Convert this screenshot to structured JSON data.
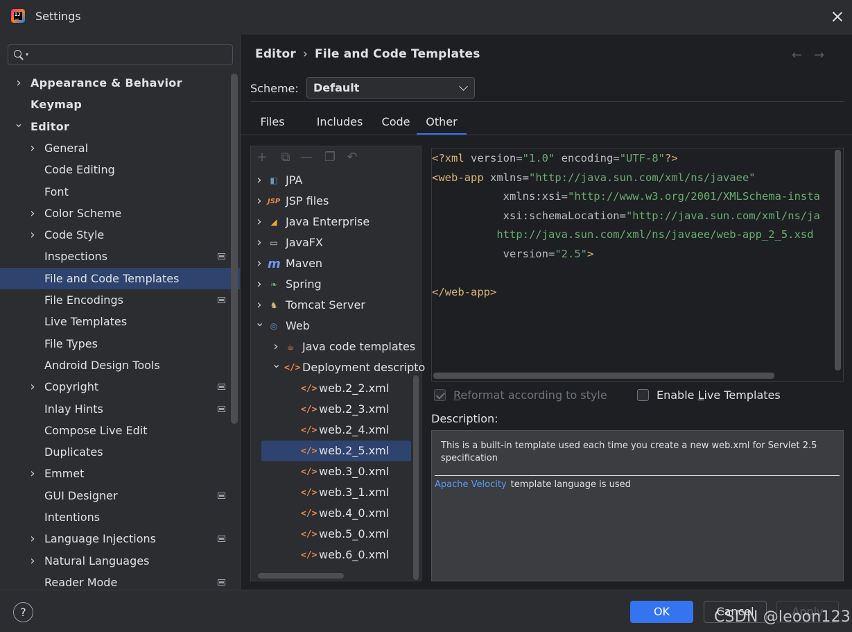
{
  "window": {
    "title": "Settings"
  },
  "sidebar": {
    "search": {
      "value": "",
      "placeholder": ""
    },
    "items": [
      {
        "label": "Appearance & Behavior",
        "expandable": true,
        "expanded": false,
        "bold": true,
        "level": 0,
        "badge": false
      },
      {
        "label": "Keymap",
        "expandable": false,
        "bold": true,
        "level": 0,
        "badge": false
      },
      {
        "label": "Editor",
        "expandable": true,
        "expanded": true,
        "bold": true,
        "level": 0,
        "badge": false
      },
      {
        "label": "General",
        "expandable": true,
        "expanded": false,
        "level": 1,
        "badge": false
      },
      {
        "label": "Code Editing",
        "expandable": false,
        "level": 1,
        "badge": false
      },
      {
        "label": "Font",
        "expandable": false,
        "level": 1,
        "badge": false
      },
      {
        "label": "Color Scheme",
        "expandable": true,
        "expanded": false,
        "level": 1,
        "badge": false
      },
      {
        "label": "Code Style",
        "expandable": true,
        "expanded": false,
        "level": 1,
        "badge": false
      },
      {
        "label": "Inspections",
        "expandable": false,
        "level": 1,
        "badge": true
      },
      {
        "label": "File and Code Templates",
        "expandable": false,
        "level": 1,
        "badge": false,
        "selected": true
      },
      {
        "label": "File Encodings",
        "expandable": false,
        "level": 1,
        "badge": true
      },
      {
        "label": "Live Templates",
        "expandable": false,
        "level": 1,
        "badge": false
      },
      {
        "label": "File Types",
        "expandable": false,
        "level": 1,
        "badge": false
      },
      {
        "label": "Android Design Tools",
        "expandable": false,
        "level": 1,
        "badge": false
      },
      {
        "label": "Copyright",
        "expandable": true,
        "expanded": false,
        "level": 1,
        "badge": true
      },
      {
        "label": "Inlay Hints",
        "expandable": false,
        "level": 1,
        "badge": true
      },
      {
        "label": "Compose Live Edit",
        "expandable": false,
        "level": 1,
        "badge": false
      },
      {
        "label": "Duplicates",
        "expandable": false,
        "level": 1,
        "badge": false
      },
      {
        "label": "Emmet",
        "expandable": true,
        "expanded": false,
        "level": 1,
        "badge": false
      },
      {
        "label": "GUI Designer",
        "expandable": false,
        "level": 1,
        "badge": true
      },
      {
        "label": "Intentions",
        "expandable": false,
        "level": 1,
        "badge": false
      },
      {
        "label": "Language Injections",
        "expandable": true,
        "expanded": false,
        "level": 1,
        "badge": true
      },
      {
        "label": "Natural Languages",
        "expandable": true,
        "expanded": false,
        "level": 1,
        "badge": false
      },
      {
        "label": "Reader Mode",
        "expandable": false,
        "level": 1,
        "badge": true
      }
    ]
  },
  "breadcrumb": {
    "parent": "Editor",
    "separator": "›",
    "current": "File and Code Templates"
  },
  "nav": {
    "back": "←",
    "forward": "→"
  },
  "scheme": {
    "label": "Scheme:",
    "value": "Default"
  },
  "tabs": [
    {
      "label": "Files",
      "active": false
    },
    {
      "label": "Includes",
      "active": false
    },
    {
      "label": "Code",
      "active": false
    },
    {
      "label": "Other",
      "active": true
    }
  ],
  "tree_toolbar": {
    "add": "+",
    "copy": "⧉",
    "remove": "—",
    "duplicate": "❐",
    "reset": "↶"
  },
  "tree": [
    {
      "label": "JPA",
      "icon": "jpa-icon",
      "glyph": "◧",
      "color": "#6897bb",
      "level": 0,
      "expandable": true,
      "expanded": false
    },
    {
      "label": "JSP files",
      "icon": "jsp-icon",
      "glyph": "JSP",
      "color": "#e8884b",
      "level": 0,
      "expandable": true,
      "expanded": false
    },
    {
      "label": "Java Enterprise",
      "icon": "java-enterprise-icon",
      "glyph": "◢",
      "color": "#f0a732",
      "level": 0,
      "expandable": true,
      "expanded": false
    },
    {
      "label": "JavaFX",
      "icon": "folder-icon",
      "glyph": "▭",
      "color": "#ced0d6",
      "level": 0,
      "expandable": true,
      "expanded": false
    },
    {
      "label": "Maven",
      "icon": "maven-icon",
      "glyph": "m",
      "color": "#6e96f0",
      "level": 0,
      "expandable": true,
      "expanded": false
    },
    {
      "label": "Spring",
      "icon": "spring-icon",
      "glyph": "❧",
      "color": "#6aab73",
      "level": 0,
      "expandable": true,
      "expanded": false
    },
    {
      "label": "Tomcat Server",
      "icon": "tomcat-icon",
      "glyph": "♞",
      "color": "#d5b778",
      "level": 0,
      "expandable": true,
      "expanded": false
    },
    {
      "label": "Web",
      "icon": "web-icon",
      "glyph": "◎",
      "color": "#6897bb",
      "level": 0,
      "expandable": true,
      "expanded": true
    },
    {
      "label": "Java code templates",
      "icon": "java-cup-icon",
      "glyph": "☕",
      "color": "#e8884b",
      "level": 1,
      "expandable": true,
      "expanded": false
    },
    {
      "label": "Deployment descripto",
      "icon": "code-tag-icon",
      "glyph": "</>",
      "color": "#e8884b",
      "level": 1,
      "expandable": true,
      "expanded": true
    },
    {
      "label": "web.2_2.xml",
      "icon": "code-tag-icon",
      "glyph": "</>",
      "color": "#e8884b",
      "level": 2,
      "expandable": false
    },
    {
      "label": "web.2_3.xml",
      "icon": "code-tag-icon",
      "glyph": "</>",
      "color": "#e8884b",
      "level": 2,
      "expandable": false
    },
    {
      "label": "web.2_4.xml",
      "icon": "code-tag-icon",
      "glyph": "</>",
      "color": "#e8884b",
      "level": 2,
      "expandable": false
    },
    {
      "label": "web.2_5.xml",
      "icon": "code-tag-icon",
      "glyph": "</>",
      "color": "#e8884b",
      "level": 2,
      "expandable": false,
      "selected": true
    },
    {
      "label": "web.3_0.xml",
      "icon": "code-tag-icon",
      "glyph": "</>",
      "color": "#e8884b",
      "level": 2,
      "expandable": false
    },
    {
      "label": "web.3_1.xml",
      "icon": "code-tag-icon",
      "glyph": "</>",
      "color": "#e8884b",
      "level": 2,
      "expandable": false
    },
    {
      "label": "web.4_0.xml",
      "icon": "code-tag-icon",
      "glyph": "</>",
      "color": "#e8884b",
      "level": 2,
      "expandable": false
    },
    {
      "label": "web.5_0.xml",
      "icon": "code-tag-icon",
      "glyph": "</>",
      "color": "#e8884b",
      "level": 2,
      "expandable": false
    },
    {
      "label": "web.6_0.xml",
      "icon": "code-tag-icon",
      "glyph": "</>",
      "color": "#e8884b",
      "level": 2,
      "expandable": false
    }
  ],
  "editor": {
    "lines": [
      [
        {
          "t": "<?",
          "c": "tag"
        },
        {
          "t": "xml ",
          "c": "tag"
        },
        {
          "t": "version",
          "c": "attr"
        },
        {
          "t": "=",
          "c": "punct"
        },
        {
          "t": "\"1.0\"",
          "c": "str"
        },
        {
          "t": " encoding",
          "c": "attr"
        },
        {
          "t": "=",
          "c": "punct"
        },
        {
          "t": "\"UTF-8\"",
          "c": "str"
        },
        {
          "t": "?>",
          "c": "tag"
        }
      ],
      [
        {
          "t": "<web-app ",
          "c": "tag"
        },
        {
          "t": "xmlns",
          "c": "attr"
        },
        {
          "t": "=",
          "c": "punct"
        },
        {
          "t": "\"http://java.sun.com/xml/ns/javaee\"",
          "c": "str"
        }
      ],
      [
        {
          "t": "           xmlns:xsi",
          "c": "attr"
        },
        {
          "t": "=",
          "c": "punct"
        },
        {
          "t": "\"http://www.w3.org/2001/XMLSchema-insta",
          "c": "str"
        }
      ],
      [
        {
          "t": "           xsi:schemaLocation",
          "c": "attr"
        },
        {
          "t": "=",
          "c": "punct"
        },
        {
          "t": "\"http://java.sun.com/xml/ns/ja",
          "c": "str"
        }
      ],
      [
        {
          "t": "          http://java.sun.com/xml/ns/javaee/web-app_2_5.xsd",
          "c": "str"
        }
      ],
      [
        {
          "t": "           version",
          "c": "attr"
        },
        {
          "t": "=",
          "c": "punct"
        },
        {
          "t": "\"2.5\"",
          "c": "str"
        },
        {
          "t": ">",
          "c": "tag"
        }
      ],
      [],
      [
        {
          "t": "</web-app>",
          "c": "tag"
        }
      ]
    ]
  },
  "options": {
    "reformat": {
      "label_pre": "",
      "label_u": "R",
      "label_post": "eformat according to style",
      "checked": true,
      "disabled": true
    },
    "live_templates": {
      "label_pre": "Enable ",
      "label_u": "L",
      "label_post": "ive Templates",
      "checked": false,
      "disabled": false
    }
  },
  "description": {
    "label": "Description:",
    "text": "This is a built-in template used each time you create a new web.xml for Servlet 2.5 specification",
    "link": "Apache Velocity",
    "suffix": "template language is used"
  },
  "footer": {
    "help": "?",
    "ok": "OK",
    "cancel": "Cancel",
    "apply": "Apply"
  },
  "watermark": "CSDN @leoon123",
  "colors": {
    "accent": "#3574f0",
    "selection": "#2e436e",
    "tag": "#d5b778",
    "string": "#6aab73",
    "link": "#589df6"
  }
}
